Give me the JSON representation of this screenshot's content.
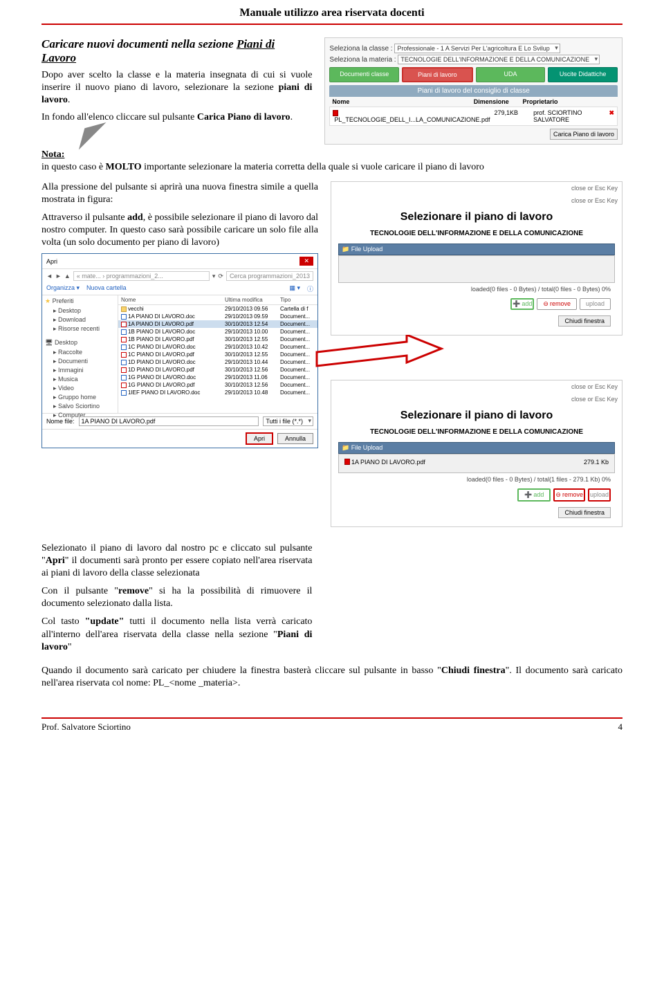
{
  "header": {
    "title": "Manuale utilizzo area riservata docenti"
  },
  "section": {
    "title_a": "Caricare nuovi documenti nella sezione ",
    "title_b": "Piani di Lavoro",
    "p1a": "Dopo aver scelto la classe e la materia insegnata di cui si vuole inserire il nuovo piano di lavoro, selezionare la sezione ",
    "p1b": "piani di lavoro",
    "p1c": ".",
    "p2a": "In fondo all'elenco cliccare sul pulsante ",
    "p2b": "Carica Piano di lavoro",
    "p2c": "."
  },
  "table_ui": {
    "lbl_classe": "Seleziona la classe :",
    "sel_classe": "Professionale - 1 A Servizi Per L'agricoltura E Lo Svilup",
    "lbl_materia": "Seleziona la materia :",
    "sel_materia": "TECNOLOGIE DELL'INFORMAZIONE E DELLA COMUNICAZIONE",
    "btn_doc": "Documenti classe",
    "btn_piani": "Piani di lavoro",
    "btn_uda": "UDA",
    "btn_uscite": "Uscite Didattiche",
    "head": "Piani di lavoro del consiglio di classe",
    "h_nome": "Nome",
    "h_dim": "Dimensione",
    "h_prop": "Proprietario",
    "row_nome": "PL_TECNOLOGIE_DELL_I...LA_COMUNICAZIONE.pdf",
    "row_dim": "279,1KB",
    "row_prop": "prof. SCIORTINO SALVATORE",
    "carica_btn": "Carica Piano di lavoro"
  },
  "nota": {
    "label": "Nota:",
    "text_a": "in questo caso è ",
    "text_b": "MOLTO",
    "text_c": " importante selezionare la materia corretta della quale si vuole caricare il piano di lavoro"
  },
  "p3": "Alla pressione del pulsante si aprirà una nuova finestra simile a quella mostrata in figura:",
  "p4a": "Attraverso il pulsante ",
  "p4b": "add",
  "p4c": ", è possibile selezionare il piano di lavoro dal nostro computer. In questo caso sarà possibile caricare un solo file alla volta (un solo documento per piano di lavoro)",
  "modal": {
    "close_hint": "close or Esc Key",
    "title": "Selezionare il piano di lavoro",
    "sub": "TECNOLOGIE DELL'INFORMAZIONE E DELLA COMUNICAZIONE",
    "file_upload": "File Upload",
    "status0": "loaded(0 files - 0 Bytes) / total(0 files - 0 Bytes) 0%",
    "status1": "loaded(0 files - 0 Bytes) / total(1 files - 279.1 Kb) 0%",
    "add": "add",
    "remove": "remove",
    "upload": "upload",
    "close_btn": "Chiudi finestra",
    "file_row": "1A PIANO DI LAVORO.pdf",
    "file_size": "279.1 Kb"
  },
  "filedlg": {
    "wtitle": "Apri",
    "breadcrumb": "« mate... › programmazioni_2...",
    "search_ph": "Cerca programmazioni_2013",
    "organizza": "Organizza ▾",
    "nuova": "Nuova cartella",
    "side_pref": "Preferiti",
    "side_items1": [
      "Desktop",
      "Download",
      "Risorse recenti"
    ],
    "side_desktop": "Desktop",
    "side_items2": [
      "Raccolte",
      "Documenti",
      "Immagini",
      "Musica",
      "Video",
      "Gruppo home",
      "Salvo Sciortino",
      "Computer"
    ],
    "h_nome": "Nome",
    "h_mod": "Ultima modifica",
    "h_tipo": "Tipo",
    "rows": [
      {
        "ico": "folder",
        "n": "vecchi",
        "d": "29/10/2013 09.56",
        "t": "Cartella di f"
      },
      {
        "ico": "doc",
        "n": "1A PIANO DI LAVORO.doc",
        "d": "29/10/2013 09.59",
        "t": "Document..."
      },
      {
        "ico": "pdfi",
        "n": "1A PIANO DI LAVORO.pdf",
        "d": "30/10/2013 12.54",
        "t": "Document...",
        "sel": true
      },
      {
        "ico": "doc",
        "n": "1B PIANO DI LAVORO.doc",
        "d": "29/10/2013 10.00",
        "t": "Document..."
      },
      {
        "ico": "pdfi",
        "n": "1B PIANO DI LAVORO.pdf",
        "d": "30/10/2013 12.55",
        "t": "Document..."
      },
      {
        "ico": "doc",
        "n": "1C PIANO DI LAVORO.doc",
        "d": "29/10/2013 10.42",
        "t": "Document..."
      },
      {
        "ico": "pdfi",
        "n": "1C PIANO DI LAVORO.pdf",
        "d": "30/10/2013 12.55",
        "t": "Document..."
      },
      {
        "ico": "doc",
        "n": "1D PIANO DI LAVORO.doc",
        "d": "29/10/2013 10.44",
        "t": "Document..."
      },
      {
        "ico": "pdfi",
        "n": "1D PIANO DI LAVORO.pdf",
        "d": "30/10/2013 12.56",
        "t": "Document..."
      },
      {
        "ico": "doc",
        "n": "1G PIANO DI LAVORO.doc",
        "d": "29/10/2013 11.06",
        "t": "Document..."
      },
      {
        "ico": "pdfi",
        "n": "1G PIANO DI LAVORO.pdf",
        "d": "30/10/2013 12.56",
        "t": "Document..."
      },
      {
        "ico": "doc",
        "n": "1IEF PIANO DI LAVORO.doc",
        "d": "29/10/2013 10.48",
        "t": "Document..."
      }
    ],
    "nome_lbl": "Nome file:",
    "nome_val": "1A PIANO DI LAVORO.pdf",
    "filter": "Tutti i file (*.*)",
    "apri": "Apri",
    "annulla": "Annulla"
  },
  "p5a": "Selezionato il piano di lavoro dal nostro pc e cliccato sul pulsante \"",
  "p5b": "Apri",
  "p5c": "\" il documenti sarà pronto per essere copiato nell'area riservata ai piani di lavoro della classe selezionata",
  "p6a": "Con il pulsante \"",
  "p6b": "remove",
  "p6c": "\" si ha la possibilità di rimuovere  il documento selezionato dalla lista.",
  "p7a": "Col tasto ",
  "p7b": "\"update\"",
  "p7c": " tutti il documento nella lista verrà caricato all'interno dell'area riservata della classe nella sezione \"",
  "p7d": "Piani di lavoro",
  "p7e": "\"",
  "p8a": "Quando il documento sarà caricato per chiudere la finestra basterà cliccare sul pulsante in basso \"",
  "p8b": "Chiudi finestra",
  "p8c": "\". Il documento sarà caricato nell'area riservata col nome: PL_<nome _materia>.",
  "footer": {
    "author": "Prof. Salvatore Sciortino",
    "page": "4"
  }
}
